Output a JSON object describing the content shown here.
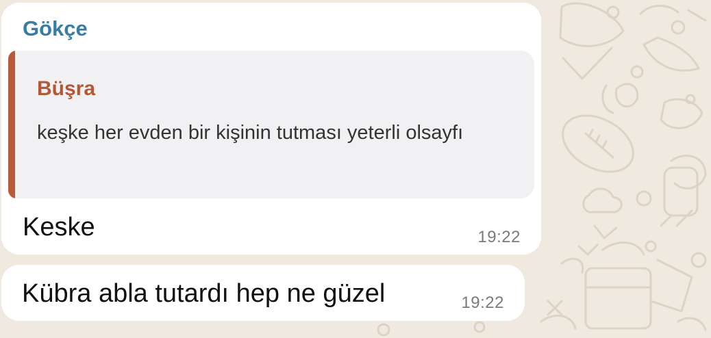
{
  "theme": {
    "background": "#efe9df",
    "bubble": "#ffffff",
    "sender_color": "#3a7da3",
    "quote_author_color": "#b45736",
    "quote_bar_color": "#b95b3b",
    "quote_background": "#f1f1f3"
  },
  "messages": [
    {
      "sender": "Gökçe",
      "quote": {
        "author": "Büşra",
        "text": "keşke her evden bir kişinin tutması yeterli olsayfı"
      },
      "text": "Keske",
      "time": "19:22"
    },
    {
      "text": "Kübra abla tutardı hep ne güzel",
      "time": "19:22"
    }
  ]
}
